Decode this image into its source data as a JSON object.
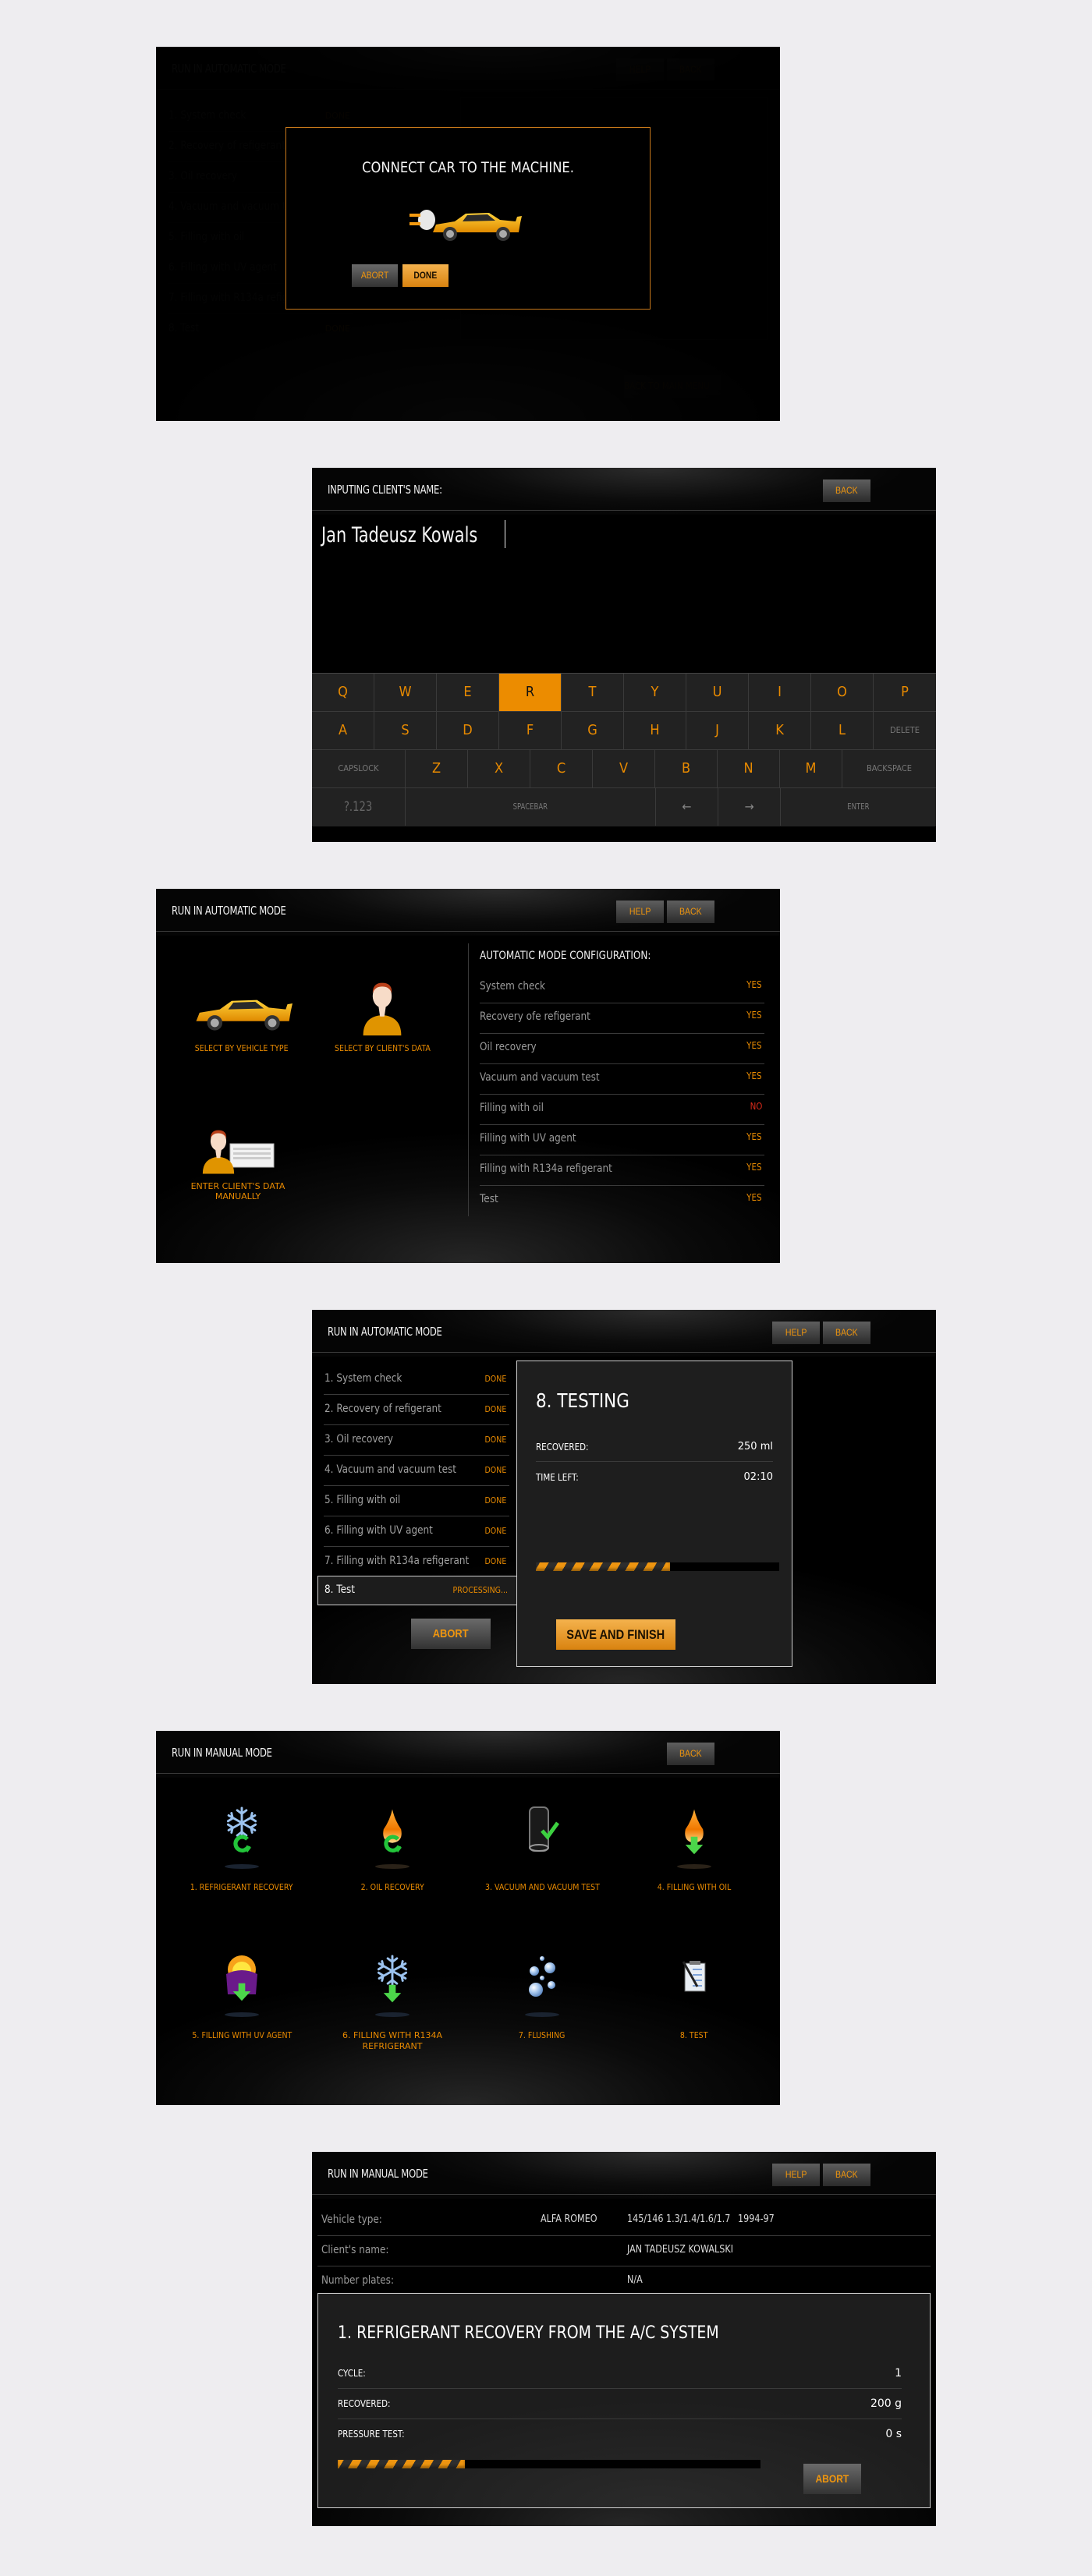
{
  "colors": {
    "accent": "#e88a00",
    "no": "#d82a1a",
    "page_bg": "#eeedf0"
  },
  "screen1": {
    "title": "RUN IN AUTOMATIC MODE",
    "help": "HELP",
    "back": "BACK",
    "steps": [
      {
        "label": "1. System check",
        "status": "DONE"
      },
      {
        "label": "2. Recovery of refigerant",
        "status": ""
      },
      {
        "label": "3. Oil recovery",
        "status": ""
      },
      {
        "label": "4. Vacuum and vacuum test",
        "status": ""
      },
      {
        "label": "5. Filling with oil",
        "status": ""
      },
      {
        "label": "6. Filling with UV agent",
        "status": ""
      },
      {
        "label": "7. Filling with R134a refigerant",
        "status": ""
      },
      {
        "label": "8. Test",
        "status": "DONE"
      }
    ],
    "completed_line1": "COMPLETED",
    "completed_line2": "SUCCESSFULLY",
    "back_to_main_menu": "BACK TO MAIN MENU",
    "modal": {
      "message": "CONNECT CAR TO THE MACHINE.",
      "icon": "car-plug-icon",
      "abort": "ABORT",
      "done": "DONE"
    }
  },
  "screen2": {
    "title": "INPUTING CLIENT'S NAME:",
    "back": "BACK",
    "input_value": "Jan Tadeusz Kowals",
    "keyboard": {
      "row1": [
        "Q",
        "W",
        "E",
        "R",
        "T",
        "Y",
        "U",
        "I",
        "O",
        "P"
      ],
      "row2": [
        "A",
        "S",
        "D",
        "F",
        "G",
        "H",
        "J",
        "K",
        "L"
      ],
      "delete": "DELETE",
      "capslock": "CAPSLOCK",
      "row3": [
        "Z",
        "X",
        "C",
        "V",
        "B",
        "N",
        "M"
      ],
      "backspace": "BACKSPACE",
      "symbols": "?.123",
      "spacebar": "SPACEBAR",
      "left": "←",
      "right": "→",
      "enter": "ENTER",
      "active_key": "R"
    }
  },
  "screen3": {
    "title": "RUN IN AUTOMATIC MODE",
    "help": "HELP",
    "back": "BACK",
    "choices": [
      {
        "label": "SELECT BY VEHICLE TYPE",
        "icon": "car-icon"
      },
      {
        "label": "SELECT BY CLIENT'S DATA",
        "icon": "person-icon"
      },
      {
        "label": "ENTER CLIENT'S DATA MANUALLY",
        "icon": "person-keyboard-icon"
      }
    ],
    "config_title": "AUTOMATIC MODE CONFIGURATION:",
    "config": [
      {
        "label": "System check",
        "value": "YES"
      },
      {
        "label": "Recovery ofe refigerant",
        "value": "YES"
      },
      {
        "label": "Oil recovery",
        "value": "YES"
      },
      {
        "label": "Vacuum and vacuum test",
        "value": "YES"
      },
      {
        "label": "Filling with oil",
        "value": "NO"
      },
      {
        "label": "Filling with UV agent",
        "value": "YES"
      },
      {
        "label": "Filling with R134a refigerant",
        "value": "YES"
      },
      {
        "label": "Test",
        "value": "YES"
      }
    ]
  },
  "screen4": {
    "title": "RUN IN AUTOMATIC MODE",
    "help": "HELP",
    "back": "BACK",
    "steps": [
      {
        "label": "1. System check",
        "status": "DONE"
      },
      {
        "label": "2. Recovery of refigerant",
        "status": "DONE"
      },
      {
        "label": "3. Oil recovery",
        "status": "DONE"
      },
      {
        "label": "4. Vacuum and vacuum test",
        "status": "DONE"
      },
      {
        "label": "5. Filling with oil",
        "status": "DONE"
      },
      {
        "label": "6. Filling with UV agent",
        "status": "DONE"
      },
      {
        "label": "7. Filling with R134a refigerant",
        "status": "DONE"
      }
    ],
    "current_step": {
      "label": "8. Test",
      "status": "PROCESSING..."
    },
    "detail_title": "8. TESTING",
    "recovered_label": "RECOVERED:",
    "recovered_value": "250 ml",
    "time_left_label": "TIME LEFT:",
    "time_left_value": "02:10",
    "progress": 0.55,
    "abort": "ABORT",
    "save_and_finish": "SAVE AND FINISH"
  },
  "screen5": {
    "title": "RUN IN MANUAL MODE",
    "back": "BACK",
    "tools": [
      {
        "label": "1. REFRIGERANT RECOVERY",
        "icon": "snowflake-recycle-icon"
      },
      {
        "label": "2. OIL RECOVERY",
        "icon": "oil-drop-recycle-icon"
      },
      {
        "label": "3. VACUUM AND VACUUM TEST",
        "icon": "vacuum-check-icon"
      },
      {
        "label": "4. FILLING WITH OIL",
        "icon": "oil-drop-arrow-down-icon"
      },
      {
        "label": "5. FILLING WITH UV AGENT",
        "icon": "uv-sun-arrow-down-icon"
      },
      {
        "label": "6. FILLING WITH R134A REFRIGERANT",
        "icon": "snowflake-arrow-down-icon"
      },
      {
        "label": "7. FLUSHING",
        "icon": "bubbles-icon"
      },
      {
        "label": "8. TEST",
        "icon": "clipboard-icon"
      }
    ]
  },
  "screen6": {
    "title": "RUN IN MANUAL MODE",
    "help": "HELP",
    "back": "BACK",
    "vehicle_type_label": "Vehicle type:",
    "vehicle_make": "ALFA ROMEO",
    "vehicle_model": "145/146 1.3/1.4/1.6/1.7",
    "vehicle_years": "1994-97",
    "client_name_label": "Client's name:",
    "client_name": "JAN TADEUSZ KOWALSKI",
    "plates_label": "Number plates:",
    "plates": "N/A",
    "operation_title": "1. REFRIGERANT RECOVERY FROM THE A/C SYSTEM",
    "cycle_label": "CYCLE:",
    "cycle_value": "1",
    "recovered_label": "RECOVERED:",
    "recovered_value": "200 g",
    "pressure_label": "PRESSURE TEST:",
    "pressure_value": "0 s",
    "progress": 0.3,
    "abort": "ABORT"
  }
}
